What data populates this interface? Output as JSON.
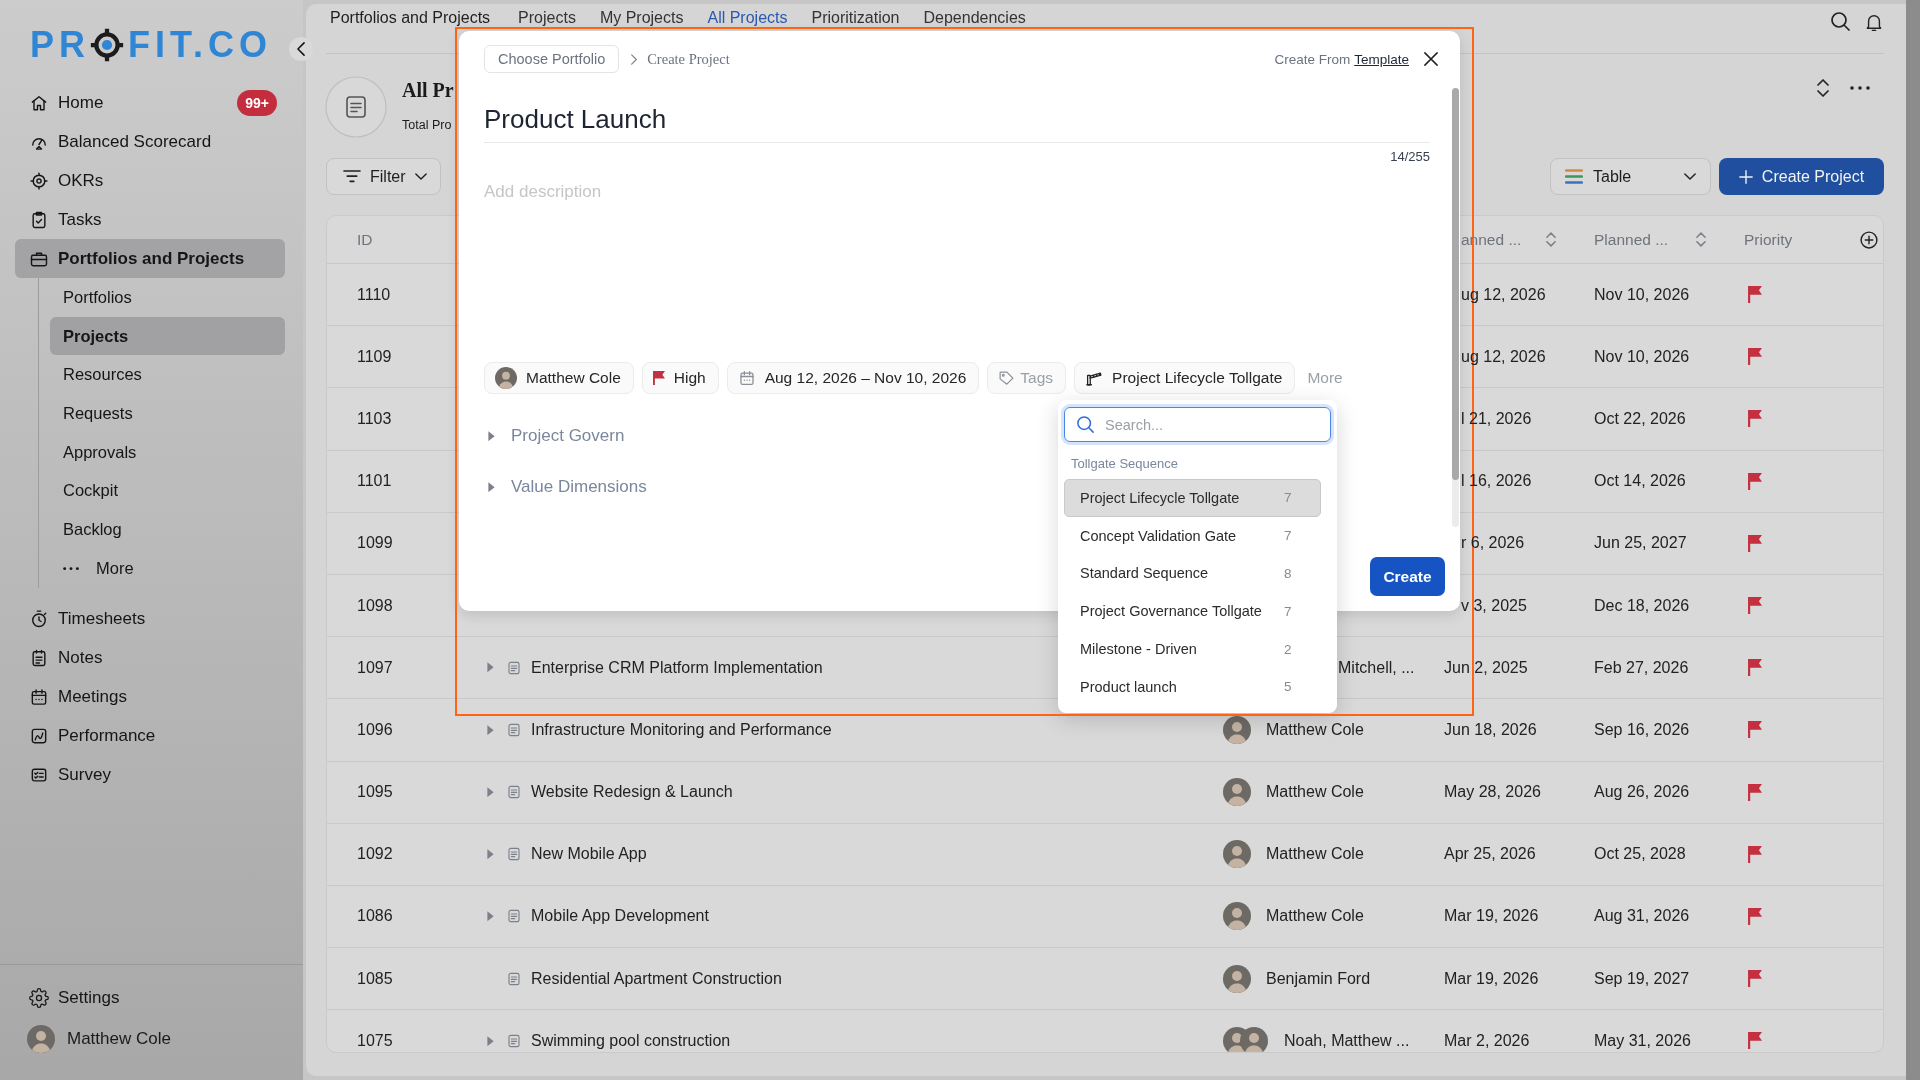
{
  "sidebar": {
    "logo": [
      "PR",
      "FIT.CO"
    ],
    "items": [
      {
        "label": "Home",
        "badge": "99+",
        "selected": false
      },
      {
        "label": "Balanced Scorecard",
        "selected": false
      },
      {
        "label": "OKRs",
        "selected": false
      },
      {
        "label": "Tasks",
        "selected": false
      },
      {
        "label": "Portfolios and Projects",
        "selected": true,
        "children": [
          {
            "label": "Portfolios",
            "kind": "link",
            "selected": false
          },
          {
            "label": "Projects",
            "kind": "link",
            "selected": true
          },
          {
            "label": "Resources",
            "kind": "link",
            "selected": false
          },
          {
            "label": "Requests",
            "kind": "link",
            "selected": false
          },
          {
            "label": "Approvals",
            "kind": "link",
            "selected": false
          },
          {
            "label": "Cockpit",
            "kind": "link",
            "selected": false
          },
          {
            "label": "Backlog",
            "kind": "link",
            "selected": false
          },
          {
            "label": "More",
            "kind": "more",
            "selected": false
          }
        ]
      },
      {
        "label": "Timesheets",
        "selected": false
      },
      {
        "label": "Notes",
        "selected": false
      },
      {
        "label": "Meetings",
        "selected": false
      },
      {
        "label": "Performance",
        "selected": false
      },
      {
        "label": "Survey",
        "selected": false
      }
    ],
    "settings": "Settings",
    "user": "Matthew Cole"
  },
  "topbar": {
    "title": "Portfolios and Projects",
    "tabs": [
      {
        "label": "Projects",
        "selected": false
      },
      {
        "label": "My Projects",
        "selected": false
      },
      {
        "label": "All Projects",
        "selected": true
      },
      {
        "label": "Prioritization",
        "selected": false
      },
      {
        "label": "Dependencies",
        "selected": false
      }
    ]
  },
  "header": {
    "title": "All Pr",
    "subtitle": "Total Pro"
  },
  "toolbar": {
    "filter": "Filter",
    "view": "Table",
    "create": "Create Project"
  },
  "table": {
    "columns": [
      {
        "label": "ID",
        "sortable": false
      },
      {
        "label": "anned ...",
        "sortable": true
      },
      {
        "label": "Planned ...",
        "sortable": true
      },
      {
        "label": "Priority",
        "sortable": false
      }
    ],
    "rows": [
      {
        "id": "1110",
        "start": "ug 12, 2026",
        "end": "Nov 10, 2026"
      },
      {
        "id": "1109",
        "start": "ug 12, 2026",
        "end": "Nov 10, 2026"
      },
      {
        "id": "1103",
        "start": "l 21, 2026",
        "end": "Oct 22, 2026"
      },
      {
        "id": "1101",
        "start": "l 16, 2026",
        "end": "Oct 14, 2026"
      },
      {
        "id": "1099",
        "start": "r 6, 2026",
        "end": "Jun 25, 2027"
      },
      {
        "id": "1098",
        "start": "v 3, 2025",
        "end": "Dec 18, 2026"
      },
      {
        "id": "1097",
        "expandable": true,
        "name": "Enterprise CRM Platform Implementation",
        "owner": {
          "kind": "text",
          "name": "Mitchell, ..."
        },
        "start": "Jun 2, 2025",
        "end": "Feb 27, 2026"
      },
      {
        "id": "1096",
        "expandable": true,
        "name": "Infrastructure Monitoring and Performance",
        "owner": {
          "kind": "single",
          "name": "Matthew Cole"
        },
        "start": "Jun 18, 2026",
        "end": "Sep 16, 2026"
      },
      {
        "id": "1095",
        "expandable": true,
        "name": "Website Redesign & Launch",
        "owner": {
          "kind": "single",
          "name": "Matthew Cole"
        },
        "start": "May 28, 2026",
        "end": "Aug 26, 2026"
      },
      {
        "id": "1092",
        "expandable": true,
        "name": "New Mobile App",
        "owner": {
          "kind": "single",
          "name": "Matthew Cole"
        },
        "start": "Apr 25, 2026",
        "end": "Oct 25, 2028"
      },
      {
        "id": "1086",
        "expandable": true,
        "name": "Mobile App Development",
        "owner": {
          "kind": "single",
          "name": "Matthew Cole"
        },
        "start": "Mar 19, 2026",
        "end": "Aug 31, 2026"
      },
      {
        "id": "1085",
        "expandable": false,
        "name": "Residential Apartment Construction",
        "owner": {
          "kind": "single",
          "name": "Benjamin Ford"
        },
        "start": "Mar 19, 2026",
        "end": "Sep 19, 2027"
      },
      {
        "id": "1075",
        "expandable": true,
        "name": "Swimming pool construction",
        "owner": {
          "kind": "pair",
          "name": "Noah, Matthew ..."
        },
        "start": "Mar 2, 2026",
        "end": "May 31, 2026"
      }
    ]
  },
  "modal": {
    "portfolio": "Choose Portfolio",
    "step": "Create Project",
    "template_prefix": "Create From",
    "template_link": "Template",
    "title": "Product Launch",
    "counter": "14/255",
    "description_placeholder": "Add description",
    "chips": [
      {
        "kind": "assignee",
        "label": "Matthew Cole"
      },
      {
        "kind": "priority",
        "label": "High"
      },
      {
        "kind": "date",
        "label": "Aug 12, 2026 – Nov 10, 2026"
      },
      {
        "kind": "tags",
        "label": "Tags"
      },
      {
        "kind": "tollgate",
        "label": "Project Lifecycle Tollgate"
      }
    ],
    "more": "More",
    "sections": [
      {
        "label": "Project Govern",
        "expanded": false
      },
      {
        "label": "Value Dimensions",
        "expanded": false
      }
    ],
    "create": "Create",
    "tollgate_menu": {
      "placeholder": "Search...",
      "group": "Tollgate Sequence",
      "options": [
        {
          "label": "Project Lifecycle Tollgate",
          "count": "7",
          "selected": true
        },
        {
          "label": "Concept Validation Gate",
          "count": "7",
          "selected": false
        },
        {
          "label": "Standard Sequence",
          "count": "8",
          "selected": false
        },
        {
          "label": "Project Governance Tollgate",
          "count": "7",
          "selected": false
        },
        {
          "label": "Milestone - Driven",
          "count": "2",
          "selected": false
        },
        {
          "label": "Product launch",
          "count": "5",
          "selected": false
        }
      ]
    }
  }
}
